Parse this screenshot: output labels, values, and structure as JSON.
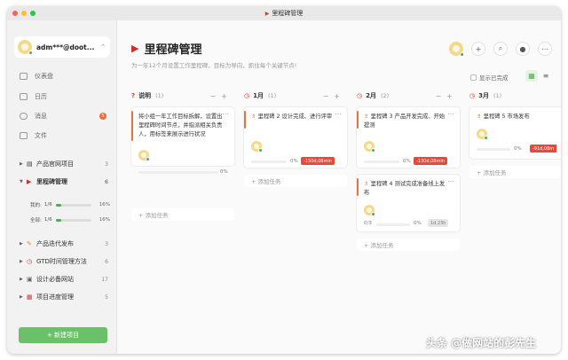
{
  "window": {
    "title": "里程碑管理"
  },
  "account": {
    "name": "adm***@doot..."
  },
  "nav": [
    {
      "label": "仪表盘"
    },
    {
      "label": "日历"
    },
    {
      "label": "消息",
      "badge": "5"
    },
    {
      "label": "文件"
    }
  ],
  "projects": [
    {
      "label": "产品官网项目",
      "count": "3"
    },
    {
      "label": "里程碑管理",
      "count": "6"
    },
    {
      "label": "产品迭代发布",
      "count": "3"
    },
    {
      "label": "GTD时间管理方法",
      "count": "6"
    },
    {
      "label": "设计必备网站",
      "count": "17"
    },
    {
      "label": "项目进度管理",
      "count": "5"
    }
  ],
  "progress": {
    "mine": {
      "label": "我的:",
      "ratio": "1/6",
      "pct": "16%",
      "value": 0.16
    },
    "all": {
      "label": "全部:",
      "ratio": "1/6",
      "pct": "16%",
      "value": 0.16
    }
  },
  "new_project": "+ 新建项目",
  "page": {
    "title": "里程碑管理",
    "desc": "为一年12个月设置工作里程碑，目标为导向，抓住每个关键节点!",
    "show_done": "显示已完成"
  },
  "columns": [
    {
      "title": "说明",
      "count": "(1)",
      "cards": [
        {
          "title": "将小组一年工作目标拆解，设置出里程碑时间节点，并指派相关负责人，用标签来展示进行状况",
          "pct": "0%"
        }
      ],
      "add": "+ 添加任务"
    },
    {
      "title": "1月",
      "count": "(1)",
      "cards": [
        {
          "title": "里程碑 2 设计完成、进行评审",
          "pct": "0%",
          "tag": "-150d,08min"
        }
      ],
      "add": "+ 添加任务"
    },
    {
      "title": "2月",
      "count": "(2)",
      "cards": [
        {
          "title": "里程碑 3 产品开发完成、开始提测",
          "pct": "0%",
          "tag": "-130d,08min"
        },
        {
          "title": "里程碑 4 测试完成准备线上发布",
          "pct": "0%",
          "sub": "0/3",
          "tag": "1d,23h"
        }
      ],
      "add": "+ 添加任务"
    },
    {
      "title": "3月",
      "count": "(1)",
      "cards": [
        {
          "title": "里程碑 5 市场发布",
          "pct": "0%",
          "tag": "-91d,08m"
        }
      ],
      "add": "+ 添加任务"
    }
  ],
  "watermark": "头条 @做网站的彭先生",
  "colors": {
    "accent_green": "#6cc06a",
    "overdue_red": "#e8473a",
    "flag_red": "#c9302c"
  }
}
